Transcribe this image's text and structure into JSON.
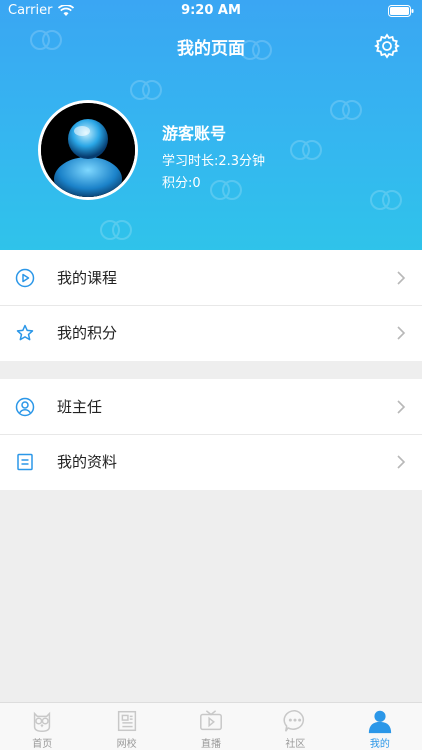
{
  "status_bar": {
    "carrier": "Carrier",
    "time": "9:20 AM"
  },
  "header": {
    "title": "我的页面",
    "user_name": "游客账号",
    "study_time": "学习时长:2.3分钟",
    "points": "积分:0"
  },
  "menu": {
    "section1": [
      {
        "label": "我的课程",
        "icon": "play-circle-icon"
      },
      {
        "label": "我的积分",
        "icon": "star-icon"
      }
    ],
    "section2": [
      {
        "label": "班主任",
        "icon": "user-circle-icon"
      },
      {
        "label": "我的资料",
        "icon": "document-icon"
      }
    ]
  },
  "tabbar": {
    "tabs": [
      {
        "label": "首页",
        "icon": "owl-icon"
      },
      {
        "label": "网校",
        "icon": "newspaper-icon"
      },
      {
        "label": "直播",
        "icon": "tv-play-icon"
      },
      {
        "label": "社区",
        "icon": "chat-bubble-icon"
      },
      {
        "label": "我的",
        "icon": "person-icon"
      }
    ],
    "active_index": 4
  },
  "colors": {
    "accent": "#2b97e8",
    "header_top": "#3aa6f3",
    "header_bottom": "#2fc3ea",
    "inactive_tab": "#999999",
    "background": "#eeeeee"
  }
}
